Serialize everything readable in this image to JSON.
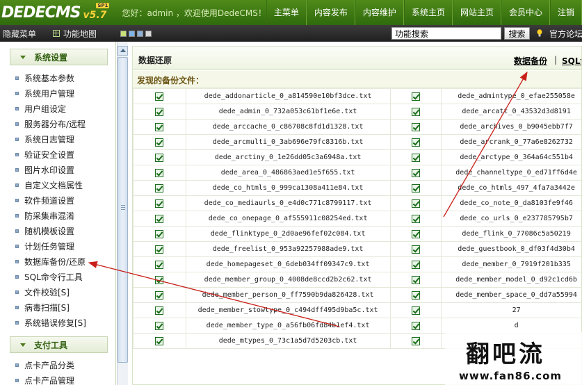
{
  "header": {
    "logo_brand": "DEDECMS",
    "logo_version": "v5.7",
    "logo_badge": "SP1",
    "welcome": "您好：admin ，欢迎使用DedeCMS！",
    "nav": [
      "主菜单",
      "内容发布",
      "内容维护",
      "系统主页",
      "网站主页",
      "会员中心",
      "注销"
    ]
  },
  "subheader": {
    "hide_menu": "隐藏菜单",
    "feature_map": "功能地图",
    "swatch_colors": [
      "#c9e078",
      "#7fb4e8",
      "#8fb0d8",
      "#d8d8d8"
    ],
    "search_value": "功能搜索",
    "search_button": "搜索",
    "forum_link": "官方论坛"
  },
  "sidebar": {
    "section1_title": "系统设置",
    "items": [
      "系统基本参数",
      "系统用户管理",
      "用户组设定",
      "服务器分布/远程",
      "系统日志管理",
      "验证安全设置",
      "图片水印设置",
      "自定义文档属性",
      "软件频道设置",
      "防采集串混淆",
      "随机模板设置",
      "计划任务管理",
      "数据库备份/还原",
      "SQL命令行工具",
      "文件校验[S]",
      "病毒扫描[S]",
      "系统错误修复[S]"
    ],
    "section2_title": "支付工具",
    "items2": [
      "点卡产品分类",
      "点卡产品管理"
    ]
  },
  "main": {
    "title": "数据还原",
    "backup_link": "数据备份",
    "separator": "|",
    "sql_link": "SQL命",
    "section_label": "发现的备份文件：",
    "rows": [
      [
        "dede_addonarticle_0_a814590e10bf3dce.txt",
        "dede_admintype_0_efae255058e"
      ],
      [
        "dede_admin_0_732a053c61bf1e6e.txt",
        "dede_arcatt_0_43532d3d8191"
      ],
      [
        "dede_arccache_0_c86708c8fd1d1328.txt",
        "dede_archives_0_b9045ebb7f7"
      ],
      [
        "dede_arcmulti_0_3ab696e79fc8316b.txt",
        "dede_arcrank_0_77a6e8262732"
      ],
      [
        "dede_arctiny_0_1e26dd05c3a6948a.txt",
        "dede_arctype_0_364a64c551b4"
      ],
      [
        "dede_area_0_486863aed1e5f655.txt",
        "dede_channeltype_0_ed71ff6d4e"
      ],
      [
        "dede_co_htmls_0_999ca1308a411e84.txt",
        "dede_co_htmls_497_4fa7a3442e"
      ],
      [
        "dede_co_mediaurls_0_e4d0c771c8799117.txt",
        "dede_co_note_0_da8103fe9f46"
      ],
      [
        "dede_co_onepage_0_af555911c08254ed.txt",
        "dede_co_urls_0_e237785795b7"
      ],
      [
        "dede_flinktype_0_2d0ae96fef02c084.txt",
        "dede_flink_0_77086c5a50219"
      ],
      [
        "dede_freelist_0_953a92257988ade9.txt",
        "dede_guestbook_0_df03f4d30b4"
      ],
      [
        "dede_homepageset_0_6deb034ff09347c9.txt",
        "dede_member_0_7919f201b335"
      ],
      [
        "dede_member_group_0_4008de8ccd2b2c62.txt",
        "dede_member_model_0_d92c1cd6b"
      ],
      [
        "dede_member_person_0_ff7590b9da826428.txt",
        "dede_member_space_0_dd7a55994"
      ],
      [
        "dede_member_stowtype_0_c494dff495d9ba5c.txt",
        "27"
      ],
      [
        "dede_member_type_0_a56fb06fd84b1ef4.txt",
        "d"
      ],
      [
        "dede_mtypes_0_73c1a5d7d5203cb.txt",
        ""
      ]
    ]
  },
  "watermark": {
    "logo": "翻吧流",
    "url": "www.fan86.com"
  }
}
